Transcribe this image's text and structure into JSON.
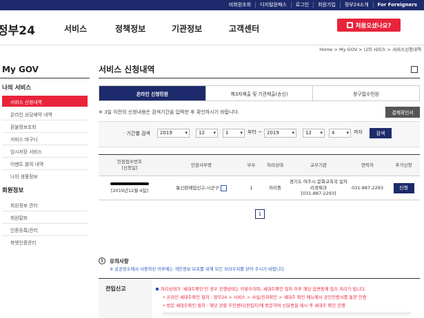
{
  "topbar": {
    "links": [
      "비회원조회",
      "디지털원패스",
      "로그인",
      "회원가입",
      "정부24소개",
      "For Foreigners"
    ]
  },
  "header": {
    "logo": "정부24",
    "nav": [
      "서비스",
      "정책정보",
      "기관정보",
      "고객센터"
    ],
    "cta_label": "처음오셨나요?"
  },
  "breadcrumb": "Home > My GOV > 나의 서비스 > 서비스신청내역",
  "sidebar": {
    "title": "My GOV",
    "groups": [
      {
        "label": "나의 서비스",
        "items": [
          "서비스 신청내역",
          "온라인 상담예약 내역",
          "환불정보조회",
          "서비스 바구니",
          "임시저장 서비스",
          "이벤트 참여 내역",
          "나의 생활정보"
        ]
      },
      {
        "label": "회원정보",
        "items": [
          "회원정보 관리",
          "회원탈퇴",
          "인증등록/관리",
          "북렛인증관리"
        ]
      }
    ]
  },
  "main": {
    "title": "서비스 신청내역",
    "tabs": [
      "온라인 신청민원",
      "제3자제출 및 기관제출(송신)",
      "창구접수민원"
    ],
    "note": "※ 3일 이전의 신청내용은 검색기간을 입력한 후 확인하시기 바랍니다.",
    "print_button": "결제확인서",
    "search": {
      "label": "· 기간별 검색",
      "from": {
        "year": "2019",
        "month": "12",
        "day": "1"
      },
      "from_suffix": "부터 ~",
      "to": {
        "year": "2019",
        "month": "12",
        "day": "4"
      },
      "to_suffix": "까지",
      "button": "검색"
    },
    "table": {
      "headers": [
        "민원접수번호\n[신청일]",
        "민원사무명",
        "부수",
        "처리상태",
        "교부기관",
        "연락처",
        "추가신청"
      ],
      "rows": [
        {
          "date": "[2019년12월 4일]",
          "name": "통신판매업신고-시군구",
          "copies": "1",
          "status": "처리중",
          "agency": "경기도 여주시 문화교육국 일자리경제과\n[031-887-2293]",
          "contact": "031-887-2293",
          "action": "신청"
        }
      ]
    },
    "pager": "1"
  },
  "notice": {
    "title": "유의사항",
    "sub": "※ 공공장소에서 사용하신 이후에는 개인정보 보호를 위해 모든 브라우저를 닫아 주시기 바랍니다.",
    "box_title": "전입신고",
    "lines": [
      "처리상태가 '세대주확인'인 경우 진행상태는 이렇수이며, 세대주확인 절차 이후 해당 읍면동에 접수 처리가 됩니다.",
      "• 온라인 세대주확인 절차 : 정부24 > 서비스 > 사실/진위확인 > 세대주 확인 메뉴에서 공인인증서를 통한 인증",
      "• 방문 세대주확인 절차 : 해당 관할 주민센터(전입지)에 방문하여 신분증을 제시 후 세대주 확인 진행"
    ]
  }
}
